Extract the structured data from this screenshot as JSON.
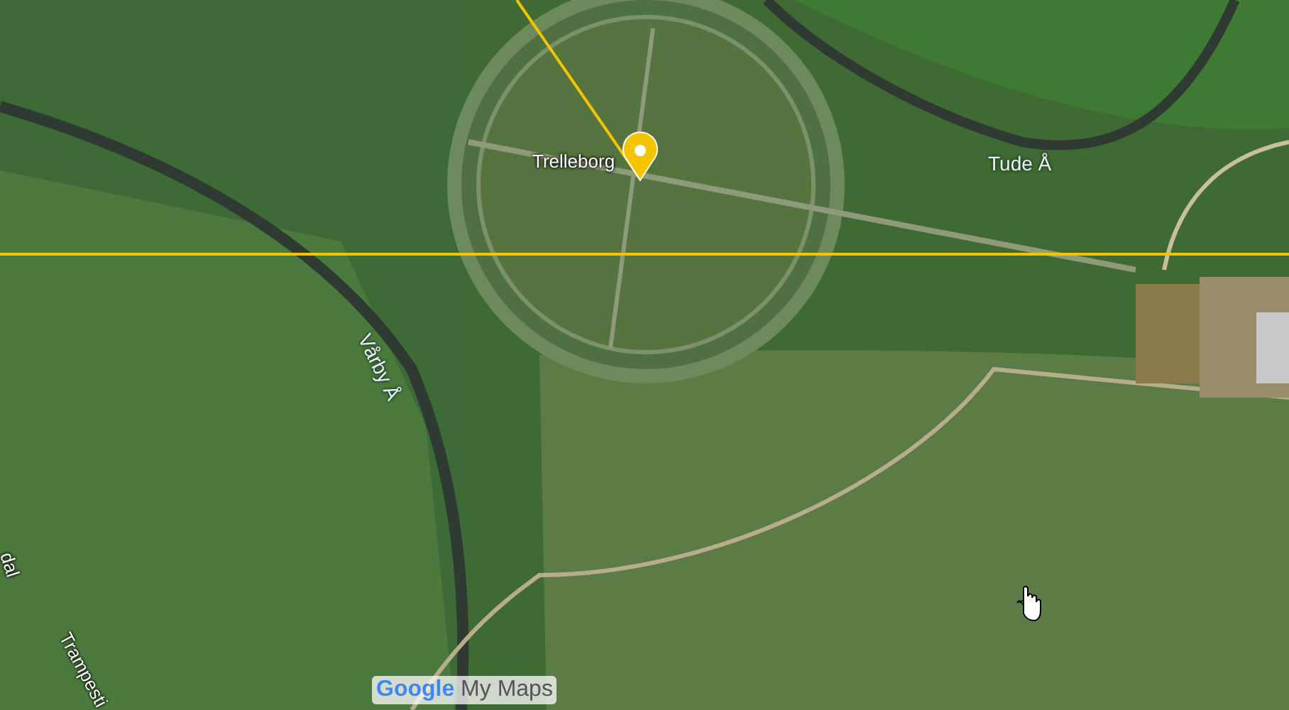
{
  "map": {
    "place": {
      "name": "Trelleborg"
    },
    "labels": [
      {
        "text": "Tude Å",
        "kind": "river"
      },
      {
        "text": "Vårby Å",
        "kind": "river"
      },
      {
        "text": "Trampesti",
        "kind": "path"
      },
      {
        "text": "dal",
        "kind": "edge"
      }
    ],
    "logo": {
      "brand": "Google",
      "product": "My Maps"
    }
  }
}
